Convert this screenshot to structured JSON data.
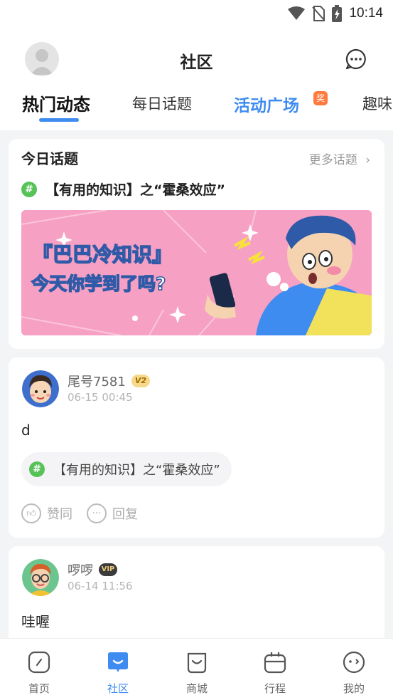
{
  "status_bar": {
    "time": "10:14",
    "icons": [
      "wifi-icon",
      "no-sim-icon",
      "battery-icon"
    ]
  },
  "header": {
    "title": "社区",
    "message_icon": "chat-bubble-icon"
  },
  "tabs": [
    {
      "label": "热门动态",
      "active": true
    },
    {
      "label": "每日话题",
      "active": false
    },
    {
      "label": "活动广场",
      "active": false,
      "badge": "奖"
    },
    {
      "label": "趣味",
      "active": false
    }
  ],
  "today_topic": {
    "title": "今日话题",
    "more": "更多话题",
    "topic": "【有用的知识】之“霍桑效应”",
    "banner": {
      "line1": "『巴巴冷知识』",
      "line2": "今天你学到了吗?"
    }
  },
  "posts": [
    {
      "user": "尾号7581",
      "level": "V2",
      "time": "06-15 00:45",
      "body": "d",
      "topic": "【有用的知识】之“霍桑效应”",
      "like_label": "赞同",
      "reply_label": "回复"
    },
    {
      "user": "啰啰",
      "level": "VIP",
      "time": "06-14 11:56",
      "body": "哇喔"
    }
  ],
  "bottom_nav": [
    {
      "label": "首页",
      "icon": "home-icon",
      "active": false
    },
    {
      "label": "社区",
      "icon": "community-icon",
      "active": true
    },
    {
      "label": "商城",
      "icon": "shop-bag-icon",
      "active": false
    },
    {
      "label": "行程",
      "icon": "trip-icon",
      "active": false
    },
    {
      "label": "我的",
      "icon": "profile-icon",
      "active": false
    }
  ],
  "colors": {
    "accent": "#3f8cf0",
    "topic_green": "#56c257",
    "badge_orange": "#ff7a3d",
    "banner_pink": "#f6a0c3"
  }
}
